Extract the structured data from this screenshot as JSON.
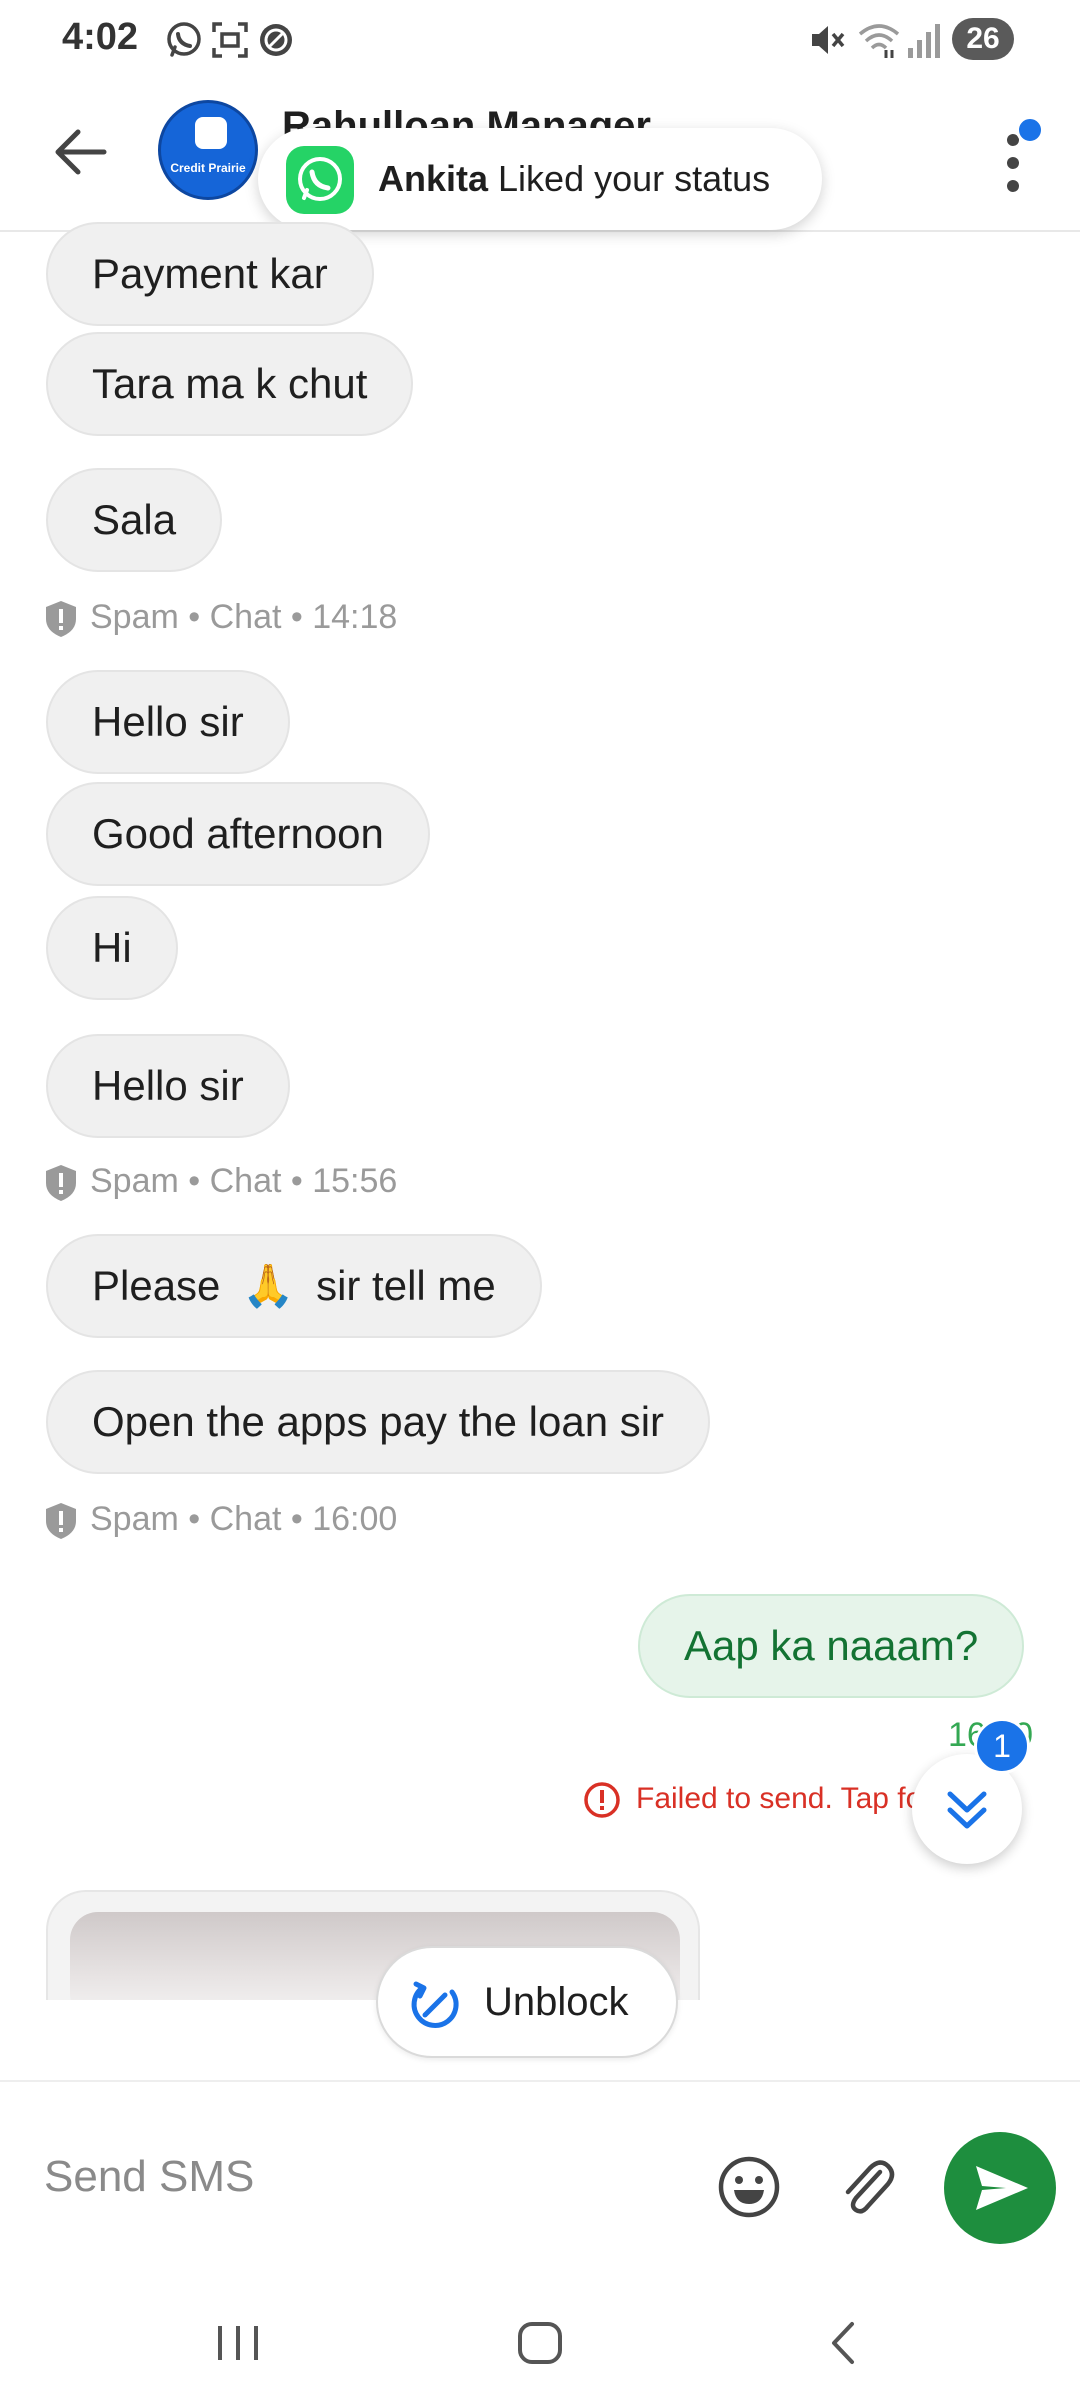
{
  "status_bar": {
    "time": "4:02",
    "battery": "26",
    "icons": [
      "whatsapp-icon",
      "screenshot-icon",
      "do-not-disturb-icon",
      "mute-icon",
      "wifi-icon",
      "signal-icon"
    ]
  },
  "header": {
    "title": "Rahulloan Manager",
    "avatar_label": "Credit Prairie",
    "back_icon": "arrow-left-icon",
    "menu_icon": "more-vert-icon"
  },
  "toast": {
    "app_icon": "whatsapp-icon",
    "name": "Ankita",
    "text": "Liked your status"
  },
  "messages": [
    {
      "text": "Payment kar"
    },
    {
      "text": "Tara ma k chut"
    },
    {
      "text": "Sala"
    },
    {
      "meta": "Spam • Chat • 14:18"
    },
    {
      "text": "Hello sir"
    },
    {
      "text": "Good afternoon"
    },
    {
      "text": "Hi"
    },
    {
      "text": "Hello sir"
    },
    {
      "meta": "Spam • Chat • 15:56"
    },
    {
      "text_before": "Please",
      "emoji": "🙏",
      "text_after": "sir tell me"
    },
    {
      "text": "Open the apps pay the loan sir"
    },
    {
      "meta": "Spam • Chat • 16:00"
    }
  ],
  "sent": {
    "text": "Aap ka naaam?",
    "time": "16:00",
    "status": "Failed to send. Tap fo"
  },
  "scroll_fab": {
    "badge": "1",
    "icon": "double-chevron-down-icon"
  },
  "unblock": {
    "label": "Unblock",
    "icon": "unblock-icon"
  },
  "composer": {
    "placeholder": "Send SMS",
    "emoji_icon": "emoji-icon",
    "attach_icon": "paperclip-icon",
    "send_icon": "send-icon"
  },
  "colors": {
    "accent": "#1a73e8",
    "sent_text": "#137333",
    "sent_bg": "#e6f4ea",
    "error": "#d93025",
    "send_button": "#1e8e3e",
    "whatsapp": "#25d366"
  }
}
